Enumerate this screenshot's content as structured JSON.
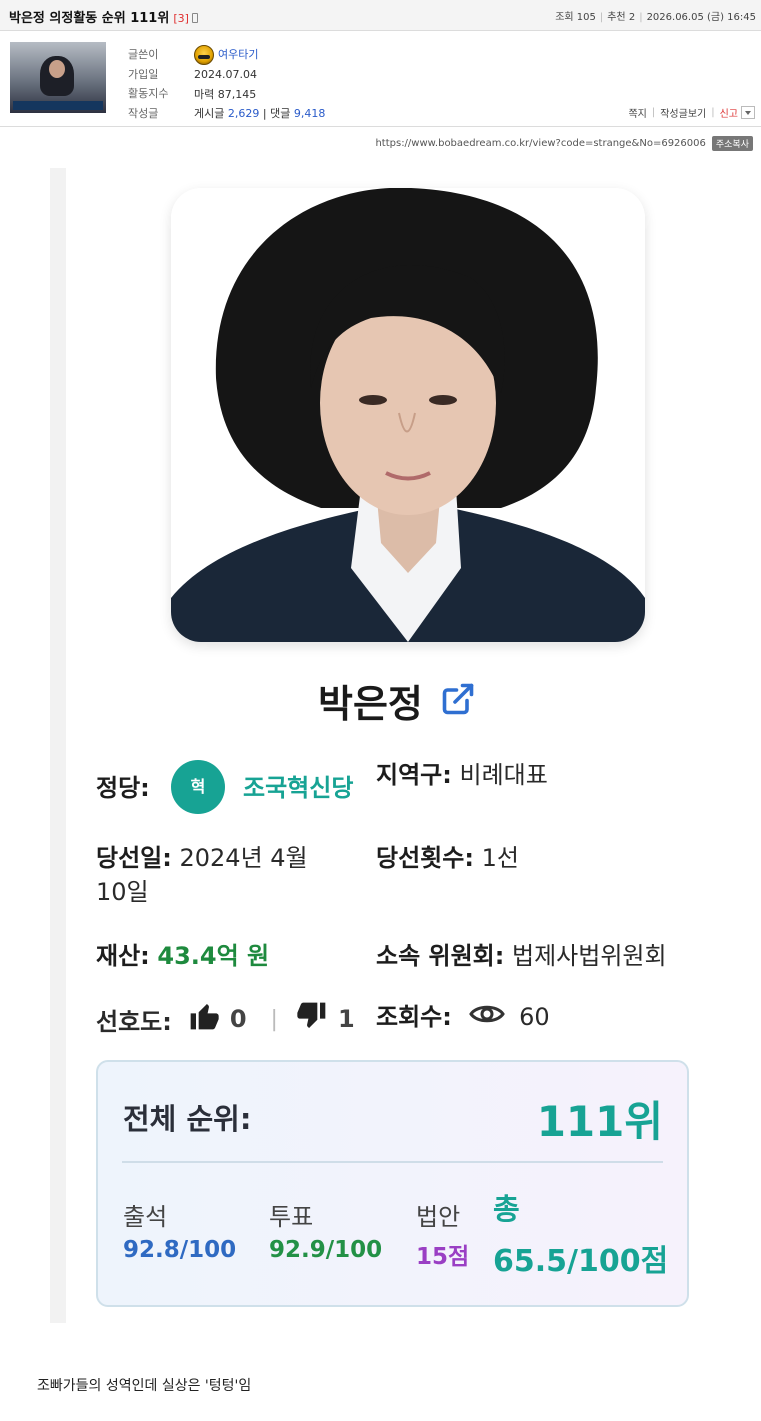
{
  "post": {
    "title": "박은정 의정활동 순위 111위",
    "comment_count": "[3]",
    "views_label": "조회 105",
    "recommend_label": "추천 2",
    "date": "2026.06.05 (금) 16:45"
  },
  "author": {
    "labels": {
      "writer": "글쓴이",
      "joined": "가입일",
      "activity": "활동지수",
      "posts": "작성글"
    },
    "nickname": "여우타기",
    "joined": "2024.07.04",
    "activity_prefix": "마력",
    "activity_value": "87,145",
    "posts_prefix": "게시글",
    "posts_value": "2,629",
    "comments_prefix": "댓글",
    "comments_value": "9,418",
    "actions": {
      "message": "쪽지",
      "view_posts": "작성글보기",
      "report": "신고"
    }
  },
  "url_bar": {
    "url": "https://www.bobaedream.co.kr/view?code=strange&No=6926006",
    "copy_label": "주소복사"
  },
  "card": {
    "name": "박은정",
    "party_label": "정당:",
    "party_icon_text": "혁",
    "party_name": "조국혁신당",
    "district_label": "지역구:",
    "district_value": "비례대표",
    "elected_date_label": "당선일:",
    "elected_date_line1": "2024년 4월",
    "elected_date_line2": "10일",
    "terms_label": "당선횟수:",
    "terms_value": "1선",
    "assets_label": "재산:",
    "assets_value": "43.4억 원",
    "committee_label": "소속 위원회:",
    "committee_value": "법제사법위원회",
    "preference_label": "선호도:",
    "likes": "0",
    "separator": "|",
    "dislikes": "1",
    "views_label": "조회수:",
    "views_value": "60"
  },
  "score": {
    "overall_label": "전체 순위:",
    "overall_rank": "111위",
    "attendance_label": "출석",
    "attendance_value": "92.8/100",
    "vote_label": "투표",
    "vote_value": "92.9/100",
    "bill_label": "법안",
    "bill_value": "15점",
    "total_label": "총",
    "total_value": "65.5/100점"
  },
  "body_text": "조빠가들의 성역인데 실상은 '텅텅'임"
}
